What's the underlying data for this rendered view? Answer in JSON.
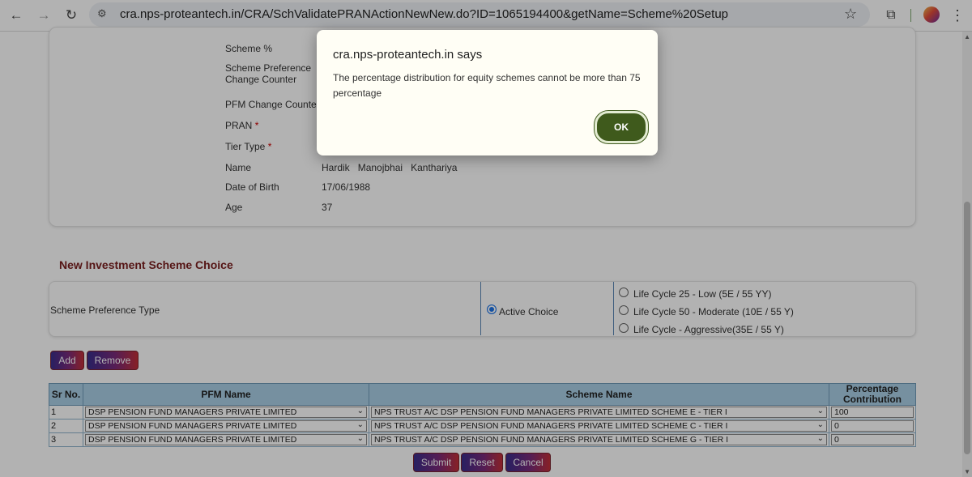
{
  "browser": {
    "url": "cra.nps-proteantech.in/CRA/SchValidatePRANActionNewNew.do?ID=1065194400&getName=Scheme%20Setup",
    "back_icon": "←",
    "forward_icon": "→",
    "reload_icon": "↻",
    "tune_icon": "⚙",
    "star_icon": "☆",
    "extensions_icon": "⧉",
    "menu_icon": "⋮"
  },
  "details": {
    "scheme_pct_label": "Scheme %",
    "scheme_pref_change_label_1": "Scheme Preference",
    "scheme_pref_change_label_2": "Change Counter",
    "pfm_change_label": "PFM Change Counter",
    "pran_label": "PRAN",
    "tier_label": "Tier Type",
    "required_mark": "*",
    "name_label": "Name",
    "name_first": "Hardik",
    "name_middle": "Manojbhai",
    "name_last": "Kanthariya",
    "dob_label": "Date of Birth",
    "dob_value": "17/06/1988",
    "age_label": "Age",
    "age_value": "37"
  },
  "section": {
    "title": "New Investment Scheme Choice",
    "pref_type_label": "Scheme Preference Type",
    "active_choice": "Active Choice",
    "lifecycle_options": [
      "Life Cycle 25 - Low (5E / 55 YY)",
      "Life Cycle 50 - Moderate (10E / 55 Y)",
      "Life Cycle - Aggressive(35E / 55 Y)"
    ]
  },
  "actions": {
    "add": "Add",
    "remove": "Remove",
    "submit": "Submit",
    "reset": "Reset",
    "cancel": "Cancel"
  },
  "table": {
    "headers": {
      "sr": "Sr No.",
      "pfm": "PFM Name",
      "scheme": "Scheme Name",
      "pct_1": "Percentage",
      "pct_2": "Contribution"
    },
    "rows": [
      {
        "sr": "1",
        "pfm": "DSP PENSION FUND MANAGERS PRIVATE LIMITED",
        "scheme": "NPS TRUST A/C DSP PENSION FUND MANAGERS PRIVATE LIMITED SCHEME E - TIER I",
        "pct": "100"
      },
      {
        "sr": "2",
        "pfm": "DSP PENSION FUND MANAGERS PRIVATE LIMITED",
        "scheme": "NPS TRUST A/C DSP PENSION FUND MANAGERS PRIVATE LIMITED SCHEME C - TIER I",
        "pct": "0"
      },
      {
        "sr": "3",
        "pfm": "DSP PENSION FUND MANAGERS PRIVATE LIMITED",
        "scheme": "NPS TRUST A/C DSP PENSION FUND MANAGERS PRIVATE LIMITED SCHEME G - TIER I",
        "pct": "0"
      }
    ]
  },
  "dialog": {
    "title": "cra.nps-proteantech.in says",
    "message": "The percentage distribution for equity schemes cannot be more than 75 percentage",
    "ok": "OK"
  },
  "colors": {
    "section_title": "#7a1f1f",
    "table_header": "#a9cfe6",
    "ok_button": "#3f5a1c",
    "required": "#cc0000"
  }
}
